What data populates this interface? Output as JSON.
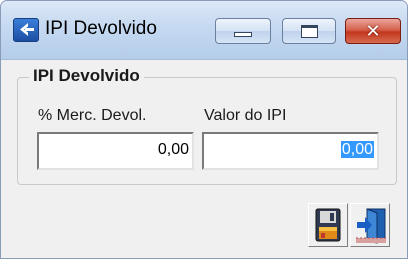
{
  "window": {
    "title": "IPI Devolvido",
    "icon": "app-icon",
    "controls": {
      "minimize_icon": "minimize-icon",
      "maximize_icon": "maximize-icon",
      "close_glyph": "✕"
    }
  },
  "group": {
    "title": "IPI Devolvido"
  },
  "fields": {
    "merc_devol": {
      "label": "% Merc. Devol.",
      "value": "0,00"
    },
    "valor_ipi": {
      "label": "Valor do IPI",
      "value": "0,00",
      "selected": true
    }
  },
  "actions": {
    "save_icon": "floppy-disk-icon",
    "exit_icon": "exit-door-icon"
  },
  "colors": {
    "selection": "#3399ff",
    "close_button": "#c3371f",
    "titlebar": "#c5d9f1"
  }
}
